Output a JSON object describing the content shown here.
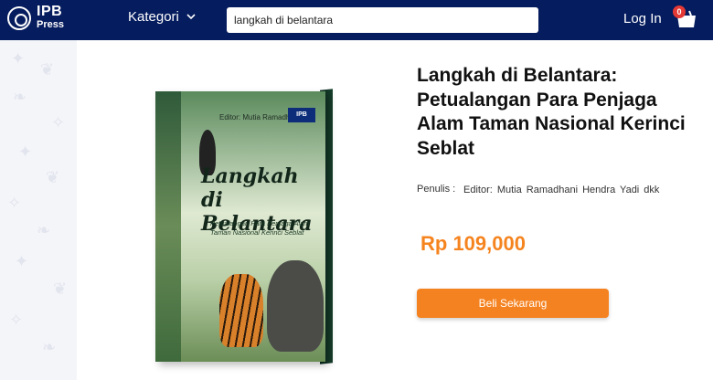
{
  "header": {
    "logo_line1": "IPB",
    "logo_line2": "Press",
    "kategori_label": "Kategori",
    "search_value": "langkah di belantara",
    "login_label": "Log In",
    "cart_count": "0"
  },
  "book_cover": {
    "editor_text": "Editor: Mutia Ramadhani",
    "publisher_badge": "IPB",
    "title_line1": "Langkah",
    "title_line2": "di Belantara",
    "subtitle": "Petualangan Para Penjaga Alam Taman Nasional Kerinci Seblat"
  },
  "product": {
    "title": "Langkah di Belantara: Petualangan Para Penjaga Alam Taman Nasional Kerinci Seblat",
    "penulis_label": "Penulis :",
    "penulis_value": "Editor: Mutia Ramadhani  Hendra Yadi dkk",
    "price": "Rp 109,000",
    "buy_label": "Beli Sekarang"
  },
  "colors": {
    "header_bg": "#051c5e",
    "accent": "#f58220",
    "badge": "#e53935"
  }
}
